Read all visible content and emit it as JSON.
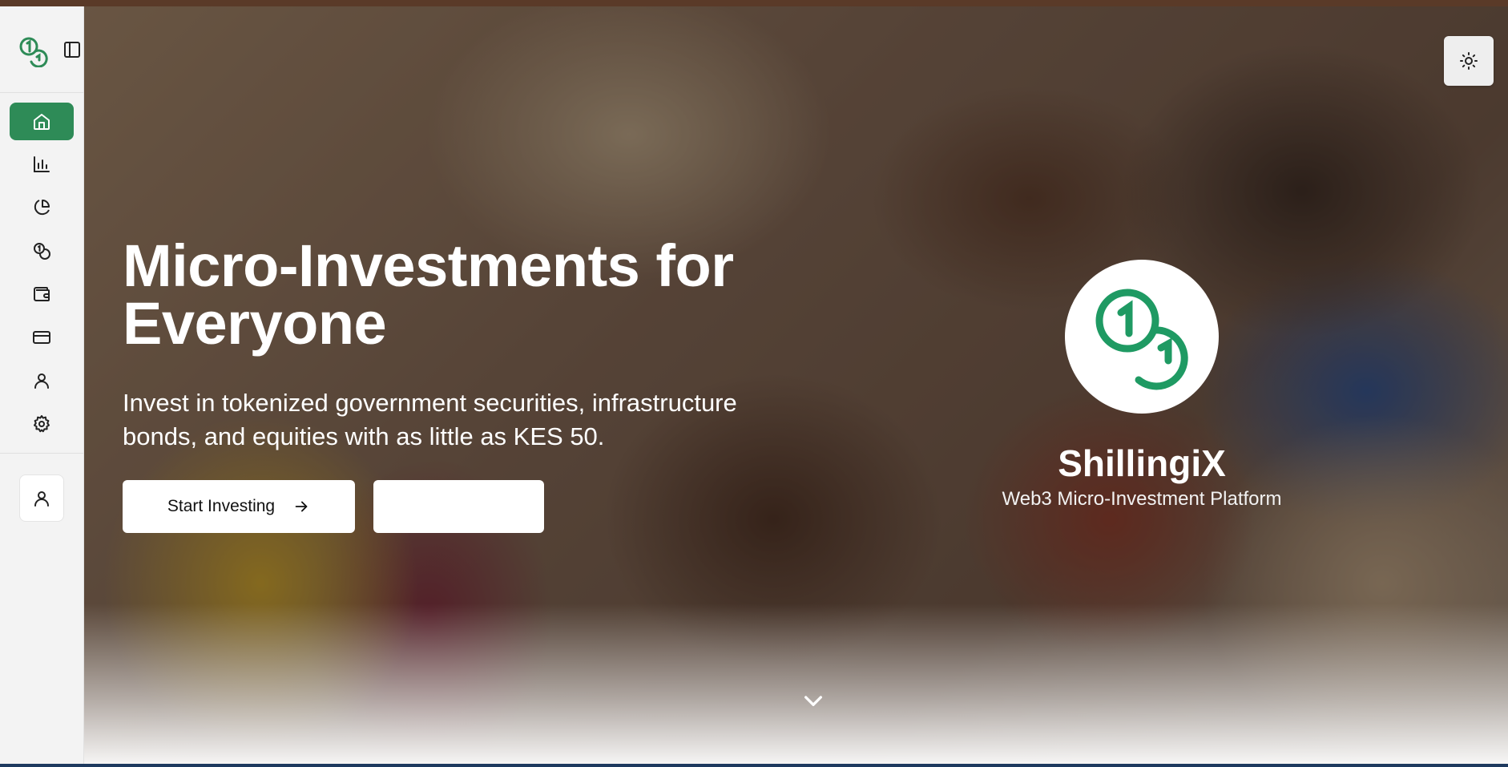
{
  "app": {
    "name": "ShillingiX",
    "accent_color": "#2e8b57"
  },
  "sidebar": {
    "logo_icon": "coins-logo-icon",
    "toggle_icon": "sidebar-toggle-icon",
    "items": [
      {
        "id": "home",
        "icon": "home-icon",
        "active": true
      },
      {
        "id": "analytics",
        "icon": "bar-chart-icon",
        "active": false
      },
      {
        "id": "portfolio",
        "icon": "pie-chart-icon",
        "active": false
      },
      {
        "id": "investments",
        "icon": "coins-icon",
        "active": false
      },
      {
        "id": "wallet",
        "icon": "wallet-icon",
        "active": false
      },
      {
        "id": "payments",
        "icon": "credit-card-icon",
        "active": false
      },
      {
        "id": "profile",
        "icon": "user-icon",
        "active": false
      },
      {
        "id": "settings",
        "icon": "gear-icon",
        "active": false
      }
    ],
    "account_icon": "user-icon"
  },
  "hero": {
    "title": "Micro-Investments for Everyone",
    "subtitle": "Invest in tokenized government securities, infrastructure bonds, and equities with as little as KES 50.",
    "primary_button": {
      "label": "Start Investing",
      "icon": "arrow-right-icon"
    },
    "secondary_button": {
      "label": ""
    },
    "brand": {
      "name": "ShillingiX",
      "tagline": "Web3 Micro-Investment Platform",
      "logo_icon": "coins-logo-icon"
    },
    "scroll_icon": "chevron-down-icon",
    "theme_toggle_icon": "sun-icon"
  }
}
